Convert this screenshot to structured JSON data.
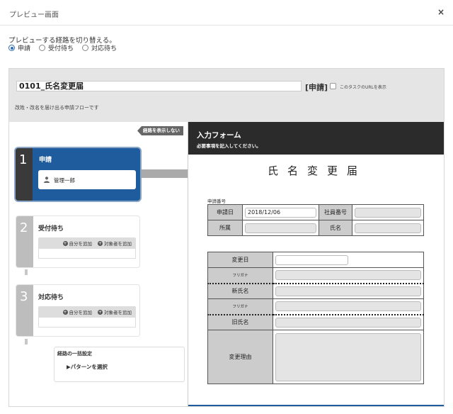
{
  "dialog": {
    "title": "プレビュー画面",
    "close": "×"
  },
  "route_switch": {
    "label": "プレビューする経路を切り替える。",
    "options": [
      "申請",
      "受付待ち",
      "対応待ち"
    ],
    "selected": "申請"
  },
  "document": {
    "title": "0101_氏名変更届",
    "status_tag": "[申請]",
    "show_url_label": "このタスクのURLを表示",
    "description": "改姓・改名を届け出る申請フローです"
  },
  "flow": {
    "hide_route_label": "経路を表示しない",
    "steps": [
      {
        "number": "1",
        "name": "申請",
        "assignee": "管理一郎"
      },
      {
        "number": "2",
        "name": "受付待ち",
        "add_self": "自分を追加",
        "add_target": "対象者を追加"
      },
      {
        "number": "3",
        "name": "対応待ち",
        "add_self": "自分を追加",
        "add_target": "対象者を追加"
      }
    ],
    "bulk": {
      "title": "経路の一括設定",
      "pattern_link": "▶パターンを選択"
    }
  },
  "form": {
    "header_title": "入力フォーム",
    "header_sub": "必要事項を記入してください。",
    "doc_title": "氏名変更届",
    "app_no_label": "申請番号",
    "fields": {
      "app_date_label": "申請日",
      "app_date_value": "2018/12/06",
      "employee_no_label": "社員番号",
      "dept_label": "所属",
      "name_label": "氏名",
      "change_date_label": "変更日",
      "furigana_label": "フリガナ",
      "new_name_label": "新氏名",
      "furigana2_label": "フリガナ",
      "old_name_label": "旧氏名",
      "reason_label": "変更理由"
    }
  },
  "colors": {
    "active_step": "#1f5c9e",
    "step_number_bg": "#3a3a3a",
    "form_header": "#2b2b2b"
  }
}
